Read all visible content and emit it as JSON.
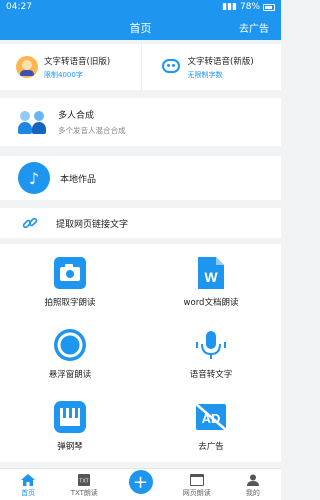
{
  "status": {
    "time": "04:27",
    "battery": "78%"
  },
  "header": {
    "title": "首页",
    "ad": "去广告"
  },
  "top_cards": [
    {
      "title": "文字转语音(旧版)",
      "sub": "限制4000字"
    },
    {
      "title": "文字转语音(新版)",
      "sub": "无限制字数"
    }
  ],
  "multi": {
    "title": "多人合成",
    "sub": "多个发音人混合合成"
  },
  "local": {
    "title": "本地作品"
  },
  "link": {
    "title": "提取网页链接文字"
  },
  "grid": [
    {
      "label": "拍照取字朗读",
      "icon": "camera-icon"
    },
    {
      "label": "word文档朗读",
      "icon": "word-doc-icon"
    },
    {
      "label": "悬浮窗朗读",
      "icon": "circle-icon"
    },
    {
      "label": "语音转文字",
      "icon": "microphone-icon"
    },
    {
      "label": "弹钢琴",
      "icon": "piano-icon"
    },
    {
      "label": "去广告",
      "icon": "no-ads-icon"
    }
  ],
  "nav": [
    {
      "label": "首页",
      "icon": "home-icon"
    },
    {
      "label": "TXT朗读",
      "icon": "txt-icon"
    },
    {
      "label": "",
      "icon": "plus-icon"
    },
    {
      "label": "网页朗读",
      "icon": "web-icon"
    },
    {
      "label": "我的",
      "icon": "user-icon"
    }
  ],
  "colors": {
    "primary": "#1e96f0"
  }
}
